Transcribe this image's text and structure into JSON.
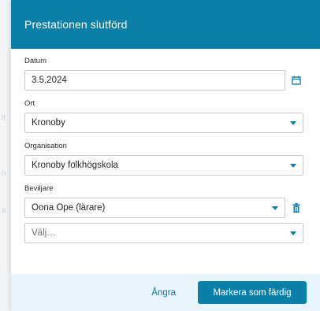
{
  "dialog": {
    "title": "Prestationen slutförd"
  },
  "fields": {
    "date": {
      "label": "Datum",
      "value": "3.5.2024"
    },
    "place": {
      "label": "Ort",
      "value": "Kronoby"
    },
    "organisation": {
      "label": "Organisation",
      "value": "Kronoby folkhögskola"
    },
    "granter": {
      "label": "Beviljare",
      "value": "Oona Ope (lärare)",
      "extra_placeholder": "Välj…"
    }
  },
  "footer": {
    "cancel_label": "Ångra",
    "confirm_label": "Markera som färdig"
  },
  "colors": {
    "accent": "#0b7fa7",
    "footer_bg": "#e8f4fb"
  },
  "icons": {
    "calendar": "calendar-icon",
    "delete": "trash-icon",
    "dropdown": "caret-down-icon"
  }
}
